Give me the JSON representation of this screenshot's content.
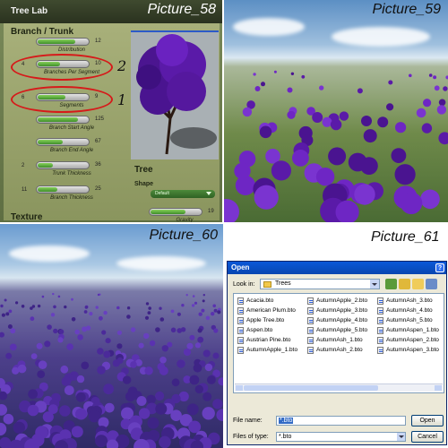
{
  "picture_58": {
    "label": "Picture_58",
    "app_title": "Tree Lab",
    "section_branch_trunk": "Branch / Trunk",
    "sliders": [
      {
        "left": "",
        "right": "12",
        "caption": "Distribution",
        "fill": 0.75
      },
      {
        "left": "4",
        "right": "10",
        "caption": "Branches Per Segment",
        "fill": 0.45
      },
      {
        "left": "6",
        "right": "9",
        "caption": "Segments",
        "fill": 0.55
      },
      {
        "left": "",
        "right": "125",
        "caption": "Branch Start Angle",
        "fill": 0.8
      },
      {
        "left": "",
        "right": "67",
        "caption": "Branch End Angle",
        "fill": 0.5
      },
      {
        "left": "2",
        "right": "36",
        "caption": "Trunk Thickness",
        "fill": 0.3
      },
      {
        "left": "11",
        "right": "25",
        "caption": "Branch Thickness",
        "fill": 0.4
      }
    ],
    "section_texture": "Texture",
    "annotations": {
      "first": "1",
      "second": "2"
    },
    "tree_panel": {
      "header": "Tree",
      "shape_label": "Shape",
      "shape_value": "Default",
      "gravity_value": "19",
      "gravity_caption": "Gravity",
      "gravity_fill": 0.7
    },
    "colors": {
      "slider_fill": "#4fa82f",
      "annotation": "#d61a1a",
      "foliage": "#5a1aa8"
    }
  },
  "picture_59": {
    "label": "Picture_59"
  },
  "picture_60": {
    "label": "Picture_60"
  },
  "picture_61": {
    "label": "Picture_61",
    "dialog_title": "Open",
    "help_glyph": "?",
    "look_in_label": "Look in:",
    "look_in_value": "Trees",
    "files_col1": [
      "Acacia.bto",
      "American Plum.bto",
      "Apple Tree.bto",
      "Aspen.bto",
      "Austrian Pine.bto",
      "AutumnApple_1.bto"
    ],
    "files_col2": [
      "AutumnApple_2.bto",
      "AutumnApple_3.bto",
      "AutumnApple_4.bto",
      "AutumnApple_5.bto",
      "AutumnAsh_1.bto",
      "AutumnAsh_2.bto"
    ],
    "files_col3": [
      "AutumnAsh_3.bto",
      "AutumnAsh_4.bto",
      "AutumnAsh_5.bto",
      "AutumnAspen_1.bto",
      "AutumnAspen_2.bto",
      "AutumnAspen_3.bto"
    ],
    "file_name_label": "File name:",
    "file_name_value": "*.bto",
    "file_type_label": "Files of type:",
    "file_type_value": "*.bto",
    "open_button": "Open",
    "cancel_button": "Cancel"
  }
}
